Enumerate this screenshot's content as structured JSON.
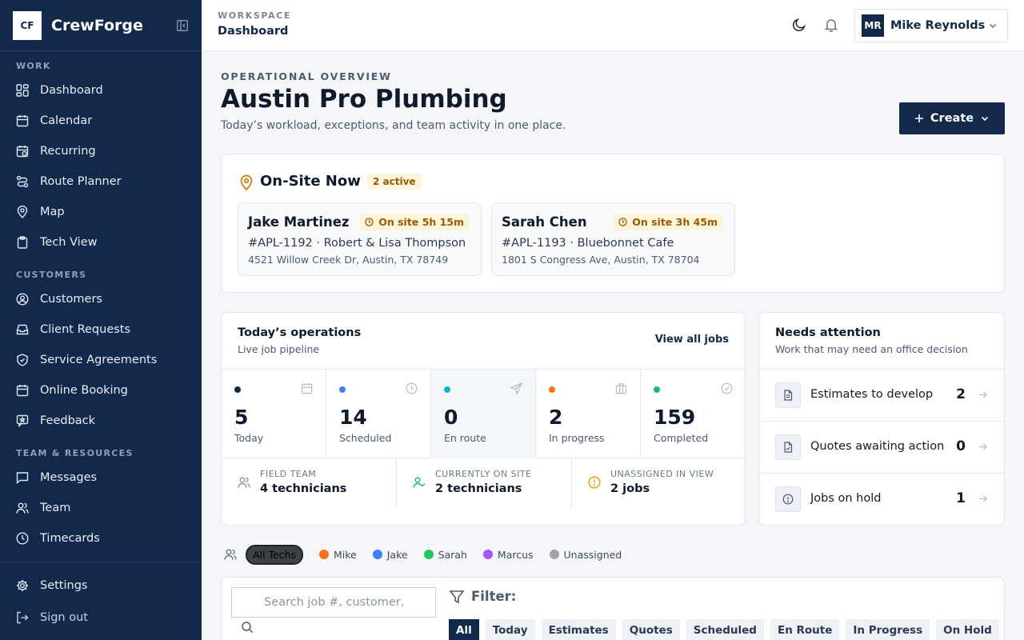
{
  "brand": {
    "logo": "CF",
    "name": "CrewForge"
  },
  "sidebar": {
    "sections": {
      "work": "WORK",
      "customers": "CUSTOMERS",
      "team": "TEAM & RESOURCES"
    },
    "items": [
      {
        "label": "Dashboard",
        "icon": "dashboard-icon"
      },
      {
        "label": "Calendar",
        "icon": "calendar-icon"
      },
      {
        "label": "Recurring",
        "icon": "recurring-icon"
      },
      {
        "label": "Route Planner",
        "icon": "route-icon"
      },
      {
        "label": "Map",
        "icon": "map-pin-icon"
      },
      {
        "label": "Tech View",
        "icon": "clipboard-icon"
      },
      {
        "label": "Customers",
        "icon": "user-circle-icon"
      },
      {
        "label": "Client Requests",
        "icon": "inbox-icon"
      },
      {
        "label": "Service Agreements",
        "icon": "shield-icon"
      },
      {
        "label": "Online Booking",
        "icon": "calendar-icon"
      },
      {
        "label": "Feedback",
        "icon": "feedback-icon"
      },
      {
        "label": "Messages",
        "icon": "message-icon"
      },
      {
        "label": "Team",
        "icon": "team-icon"
      },
      {
        "label": "Timecards",
        "icon": "clock-icon"
      }
    ],
    "settings": "Settings",
    "signout": "Sign out"
  },
  "topbar": {
    "eyebrow": "WORKSPACE",
    "page": "Dashboard",
    "user_initials": "MR",
    "user_name": "Mike Reynolds"
  },
  "header": {
    "eyebrow": "OPERATIONAL OVERVIEW",
    "title": "Austin Pro Plumbing",
    "subtitle": "Today’s workload, exceptions, and team activity in one place.",
    "create": "Create"
  },
  "onsite": {
    "title": "On-Site Now",
    "badge": "2 active",
    "techs": [
      {
        "name": "Jake Martinez",
        "time": "On site 5h 15m",
        "job": "#APL-1192 · Robert & Lisa Thompson",
        "addr": "4521 Willow Creek Dr, Austin, TX 78749"
      },
      {
        "name": "Sarah Chen",
        "time": "On site 3h 45m",
        "job": "#APL-1193 · Bluebonnet Cafe",
        "addr": "1801 S Congress Ave, Austin, TX 78704"
      }
    ]
  },
  "ops": {
    "title": "Today’s operations",
    "subtitle": "Live job pipeline",
    "view_all": "View all jobs",
    "stats": [
      {
        "num": "5",
        "label": "Today",
        "color": "#13294b"
      },
      {
        "num": "14",
        "label": "Scheduled",
        "color": "#3b82f6"
      },
      {
        "num": "0",
        "label": "En route",
        "color": "#06b6d4"
      },
      {
        "num": "2",
        "label": "In progress",
        "color": "#f97316"
      },
      {
        "num": "159",
        "label": "Completed",
        "color": "#10b981"
      }
    ],
    "team": [
      {
        "label": "FIELD TEAM",
        "value": "4 technicians"
      },
      {
        "label": "CURRENTLY ON SITE",
        "value": "2 technicians"
      },
      {
        "label": "UNASSIGNED IN VIEW",
        "value": "2 jobs"
      }
    ]
  },
  "attention": {
    "title": "Needs attention",
    "subtitle": "Work that may need an office decision",
    "rows": [
      {
        "label": "Estimates to develop",
        "count": "2"
      },
      {
        "label": "Quotes awaiting action",
        "count": "0"
      },
      {
        "label": "Jobs on hold",
        "count": "1"
      }
    ]
  },
  "tech_filter": {
    "all": "All Techs",
    "techs": [
      {
        "name": "Mike",
        "color": "#f97316"
      },
      {
        "name": "Jake",
        "color": "#3b82f6"
      },
      {
        "name": "Sarah",
        "color": "#22c55e"
      },
      {
        "name": "Marcus",
        "color": "#a855f7"
      },
      {
        "name": "Unassigned",
        "color": "#9ca3af"
      }
    ]
  },
  "jobs": {
    "search_placeholder": "Search job #, customer,",
    "filter_label": "Filter:",
    "tabs": [
      "All",
      "Today",
      "Estimates",
      "Quotes",
      "Scheduled",
      "En Route",
      "In Progress",
      "On Hold"
    ]
  }
}
